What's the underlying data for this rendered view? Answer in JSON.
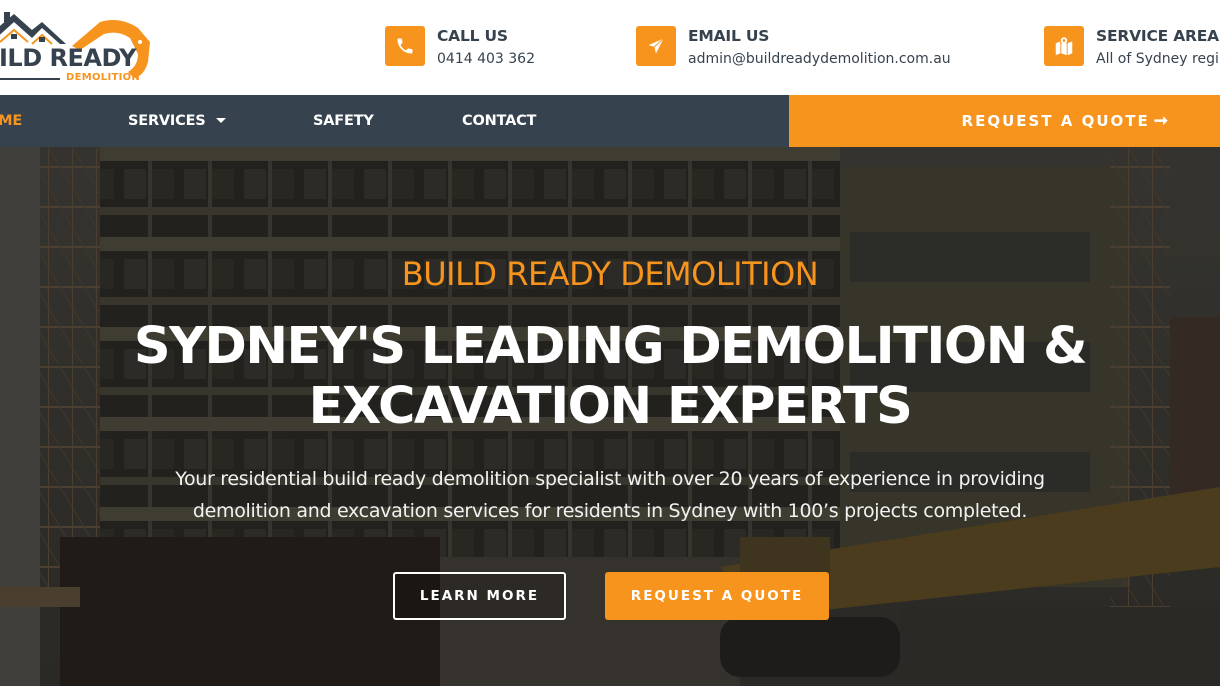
{
  "brand": {
    "name_line": "UILD READY",
    "sub_line": "DEMOLITION",
    "logo_icon": "house-excavator-logo",
    "colors": {
      "accent": "#f7941e",
      "dark": "#36434f"
    }
  },
  "header": {
    "contacts": [
      {
        "icon": "phone-icon",
        "title": "CALL US",
        "value": "0414 403 362"
      },
      {
        "icon": "paper-plane-icon",
        "title": "EMAIL US",
        "value": "admin@buildreadydemolition.com.au"
      },
      {
        "icon": "map-pin-icon",
        "title": "SERVICE AREA",
        "value": "All of Sydney regi"
      }
    ]
  },
  "nav": {
    "items": [
      {
        "label": "OME",
        "active": true
      },
      {
        "label": "SERVICES",
        "has_dropdown": true
      },
      {
        "label": "SAFETY"
      },
      {
        "label": "CONTACT"
      }
    ],
    "cta_label": "REQUEST A QUOTE",
    "cta_arrow": "➞"
  },
  "hero": {
    "eyebrow": "BUILD READY DEMOLITION",
    "title_line1": "SYDNEY'S LEADING DEMOLITION &",
    "title_line2": "EXCAVATION EXPERTS",
    "desc_line1": "Your residential build ready demolition specialist with over 20 years of experience in providing",
    "desc_line2": "demolition and excavation services for residents in Sydney with 100’s projects completed.",
    "buttons": {
      "learn_more": "LEARN MORE",
      "request_quote": "REQUEST A QUOTE"
    },
    "background": "demolition-site-photo"
  }
}
